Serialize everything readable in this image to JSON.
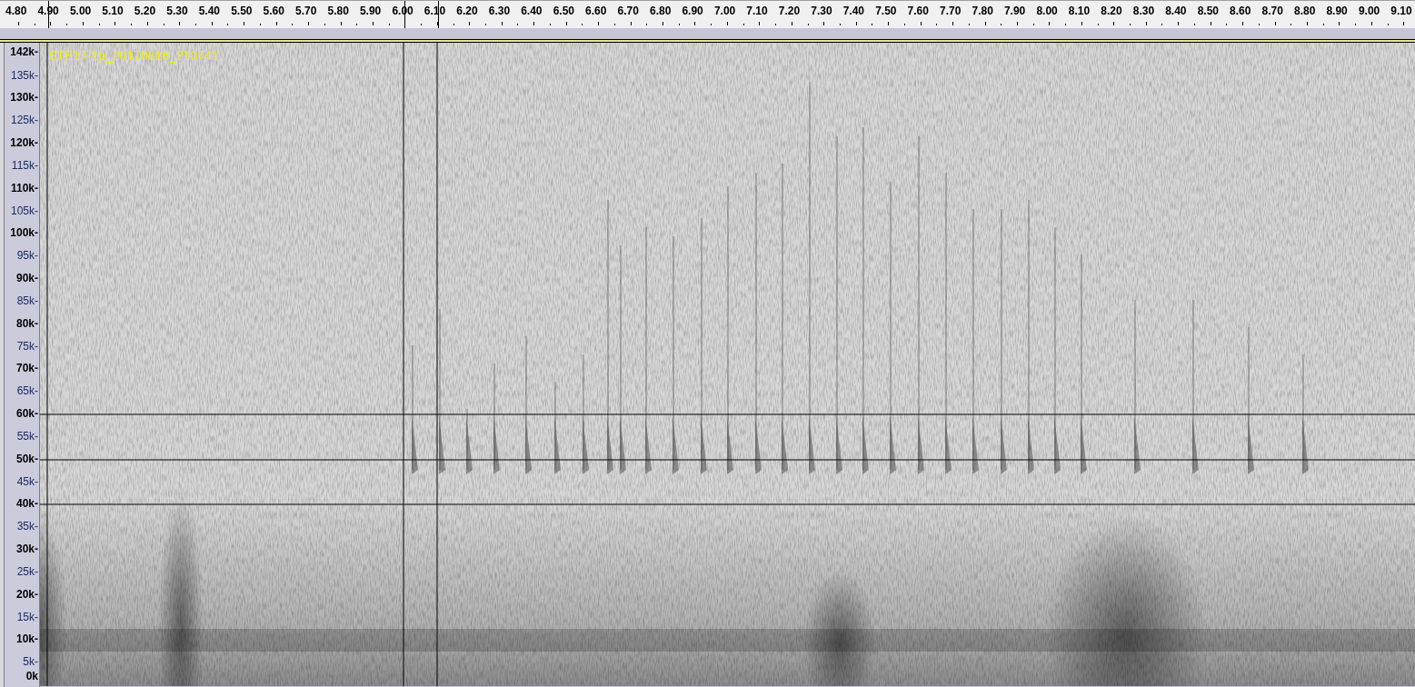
{
  "ruler": {
    "ticks": [
      "4.80",
      "4.90",
      "5.00",
      "5.10",
      "5.20",
      "5.30",
      "5.40",
      "5.50",
      "5.60",
      "5.70",
      "5.80",
      "5.90",
      "6.00",
      "6.10",
      "6.20",
      "6.30",
      "6.40",
      "6.50",
      "6.60",
      "6.70",
      "6.80",
      "6.90",
      "7.00",
      "7.10",
      "7.20",
      "7.30",
      "7.40",
      "7.50",
      "7.60",
      "7.70",
      "7.80",
      "7.90",
      "8.00",
      "8.10",
      "8.20",
      "8.30",
      "8.40",
      "8.50",
      "8.60",
      "8.70",
      "8.80",
      "8.90",
      "9.00",
      "9.10"
    ]
  },
  "track": {
    "name": "STE17-1p_20170816_210741",
    "frequency_axis": [
      {
        "label": "142k-",
        "kind": "major"
      },
      {
        "label": "135k-",
        "kind": "minor"
      },
      {
        "label": "130k-",
        "kind": "major"
      },
      {
        "label": "125k-",
        "kind": "minor"
      },
      {
        "label": "120k-",
        "kind": "major"
      },
      {
        "label": "115k-",
        "kind": "minor"
      },
      {
        "label": "110k-",
        "kind": "major"
      },
      {
        "label": "105k-",
        "kind": "minor"
      },
      {
        "label": "100k-",
        "kind": "major"
      },
      {
        "label": "95k-",
        "kind": "minor"
      },
      {
        "label": "90k-",
        "kind": "major"
      },
      {
        "label": "85k-",
        "kind": "minor"
      },
      {
        "label": "80k-",
        "kind": "major"
      },
      {
        "label": "75k-",
        "kind": "minor"
      },
      {
        "label": "70k-",
        "kind": "major"
      },
      {
        "label": "65k-",
        "kind": "minor"
      },
      {
        "label": "60k-",
        "kind": "major"
      },
      {
        "label": "55k-",
        "kind": "minor"
      },
      {
        "label": "50k-",
        "kind": "major"
      },
      {
        "label": "45k-",
        "kind": "minor"
      },
      {
        "label": "40k-",
        "kind": "major"
      },
      {
        "label": "35k-",
        "kind": "minor"
      },
      {
        "label": "30k-",
        "kind": "major"
      },
      {
        "label": "25k-",
        "kind": "minor"
      },
      {
        "label": "20k-",
        "kind": "major"
      },
      {
        "label": "15k-",
        "kind": "minor"
      },
      {
        "label": "10k-",
        "kind": "major"
      },
      {
        "label": "5k-",
        "kind": "minor"
      },
      {
        "label": "0k",
        "kind": "major"
      }
    ]
  }
}
